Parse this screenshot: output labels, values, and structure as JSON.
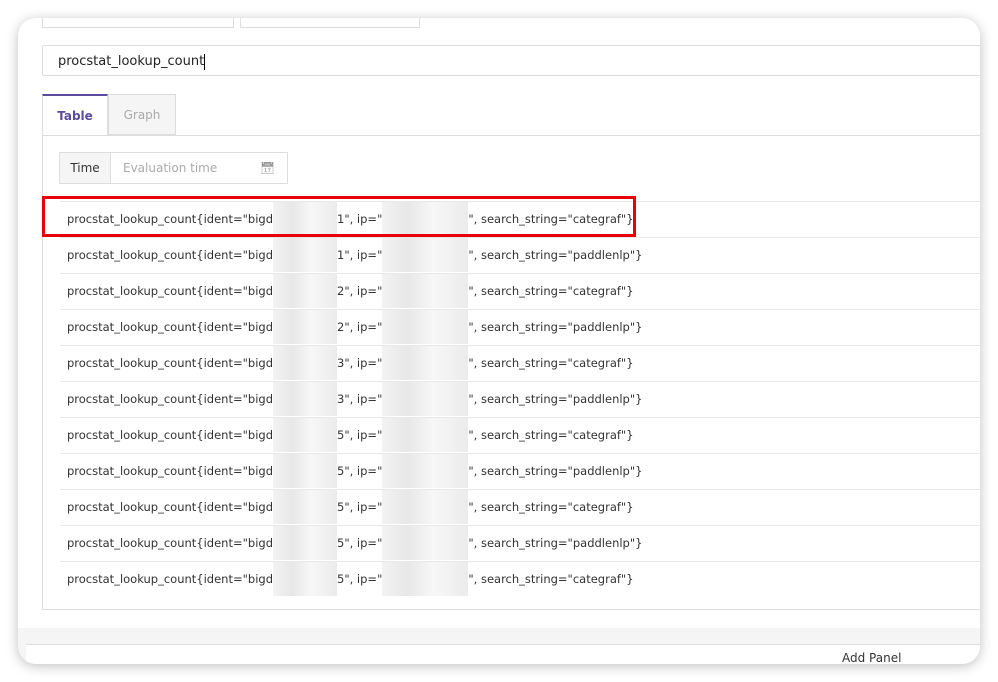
{
  "query": {
    "value": "procstat_lookup_count"
  },
  "tabs": [
    {
      "label": "Table",
      "active": true
    },
    {
      "label": "Graph",
      "active": false
    }
  ],
  "time": {
    "label": "Time",
    "placeholder": "Evaluation time",
    "icon": "calendar-icon"
  },
  "rows": [
    {
      "prefix": "procstat_lookup_count{ident=\"bigd",
      "mid": "1\", ip=\"",
      "suffix": "\", search_string=\"categraf\"}"
    },
    {
      "prefix": "procstat_lookup_count{ident=\"bigd",
      "mid": "1\", ip=\"",
      "suffix": "\", search_string=\"paddlenlp\"}"
    },
    {
      "prefix": "procstat_lookup_count{ident=\"bigd",
      "mid": "2\", ip=\"",
      "suffix": "\", search_string=\"categraf\"}"
    },
    {
      "prefix": "procstat_lookup_count{ident=\"bigd",
      "mid": "2\", ip=\"",
      "suffix": "\", search_string=\"paddlenlp\"}"
    },
    {
      "prefix": "procstat_lookup_count{ident=\"bigd",
      "mid": "3\", ip=\"",
      "suffix": "\", search_string=\"categraf\"}"
    },
    {
      "prefix": "procstat_lookup_count{ident=\"bigd",
      "mid": "3\", ip=\"",
      "suffix": "\", search_string=\"paddlenlp\"}"
    },
    {
      "prefix": "procstat_lookup_count{ident=\"bigd",
      "mid": "5\", ip=\"",
      "suffix": "\", search_string=\"categraf\"}"
    },
    {
      "prefix": "procstat_lookup_count{ident=\"bigd",
      "mid": "5\", ip=\"",
      "suffix": "\", search_string=\"paddlenlp\"}"
    },
    {
      "prefix": "procstat_lookup_count{ident=\"bigd",
      "mid": "5\", ip=\"",
      "suffix": "\", search_string=\"categraf\"}"
    },
    {
      "prefix": "procstat_lookup_count{ident=\"bigd",
      "mid": "5\", ip=\"",
      "suffix": "\", search_string=\"paddlenlp\"}"
    },
    {
      "prefix": "procstat_lookup_count{ident=\"bigd",
      "mid": "5\", ip=\"",
      "suffix": "\", search_string=\"categraf\"}"
    }
  ],
  "highlight_color": "#e8000b",
  "accent_color": "#5b4b9a",
  "footer": {
    "add_panel": "Add Panel"
  }
}
